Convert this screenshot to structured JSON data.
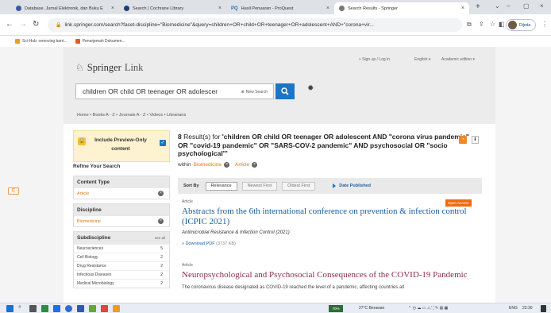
{
  "browser": {
    "tabs": [
      {
        "title": "Database, Jurnal Elektronik, dan Buku E",
        "color": "#3b5ba5"
      },
      {
        "title": "Search | Cochrane Library",
        "color": "#1f3f7a"
      },
      {
        "title": "Hasil Penuaran - ProQuest",
        "color": "#2b6fb5",
        "prefix": "PQ"
      },
      {
        "title": "Search Results - Springer",
        "color": "#555555"
      }
    ],
    "new_tab": "+",
    "url": "link.springer.com/search?facet-discipline=\"Biomedicine\"&query=children+OR+child+OR+teenager+OR+adolescent+AND+\"corona+vir...",
    "profile_label": "Dijeda",
    "bookmarks": [
      {
        "label": "Sci-Hub: removing barri...",
        "color": "#e8a020"
      },
      {
        "label": "Penerjemah Dokumen...",
        "color": "#e06020"
      }
    ]
  },
  "header": {
    "logo": "Springer",
    "logo_suffix": "Link",
    "signup": "» Sign up / Log in",
    "language": "English",
    "academic": "Academic edition",
    "search_value": "children OR child OR teenager OR adolescer",
    "new_search": "New Search",
    "breadcrumbs": "Home  •  Books A - Z  •  Journals A - Z  •  Videos  •  Librarians"
  },
  "sidebar": {
    "preview_label": "Include Preview-Only content",
    "refine_title": "Refine Your Search",
    "content_type": {
      "title": "Content Type",
      "selected": "Article"
    },
    "discipline": {
      "title": "Discipline",
      "selected": "Biomedicine"
    },
    "subdiscipline": {
      "title": "Subdiscipline",
      "see_all": "see all",
      "items": [
        {
          "label": "Neurosciences",
          "count": "5"
        },
        {
          "label": "Cell Biology",
          "count": "2"
        },
        {
          "label": "Drug Resistance",
          "count": "2"
        },
        {
          "label": "Infectious Diseases",
          "count": "2"
        },
        {
          "label": "Medical Microbiology",
          "count": "2"
        }
      ]
    }
  },
  "results": {
    "count": "8",
    "heading_prefix": "Result(s) for",
    "query_text": "'children OR child OR teenager OR adolescent AND \"corona virus pandemic\" OR \"covid-19 pandemic\" OR \"SARS-COV-2 pandemic\" AND psychosocial OR \"socio psychological\"'",
    "within_label": "within",
    "within_discipline": "Biomedicine",
    "within_type": "Article",
    "sort_label": "Sort By",
    "sort_options": [
      "Relevance",
      "Newest First",
      "Oldest First"
    ],
    "date_published": "Date Published",
    "items": [
      {
        "type": "Article",
        "title": "Abstracts from the 6th international conference on prevention & infection control (ICPIC 2021)",
        "journal": "Antimicrobial Resistance & Infection Control (2021)",
        "pdf_label": "» Download PDF",
        "pdf_size": "(3737 KB)",
        "badge": "Open Access"
      },
      {
        "type": "Article",
        "title": "Neuropsychological and Psychosocial Consequences of the COVID-19 Pandemic",
        "snippet": "The coronavirus disease designated as COVID-19 reached the level of a pandemic, affecting countries all"
      }
    ]
  },
  "taskbar": {
    "weather_chip": "70%",
    "weather": "27°C Berawan",
    "lang": "ENG",
    "time": "23:30"
  }
}
